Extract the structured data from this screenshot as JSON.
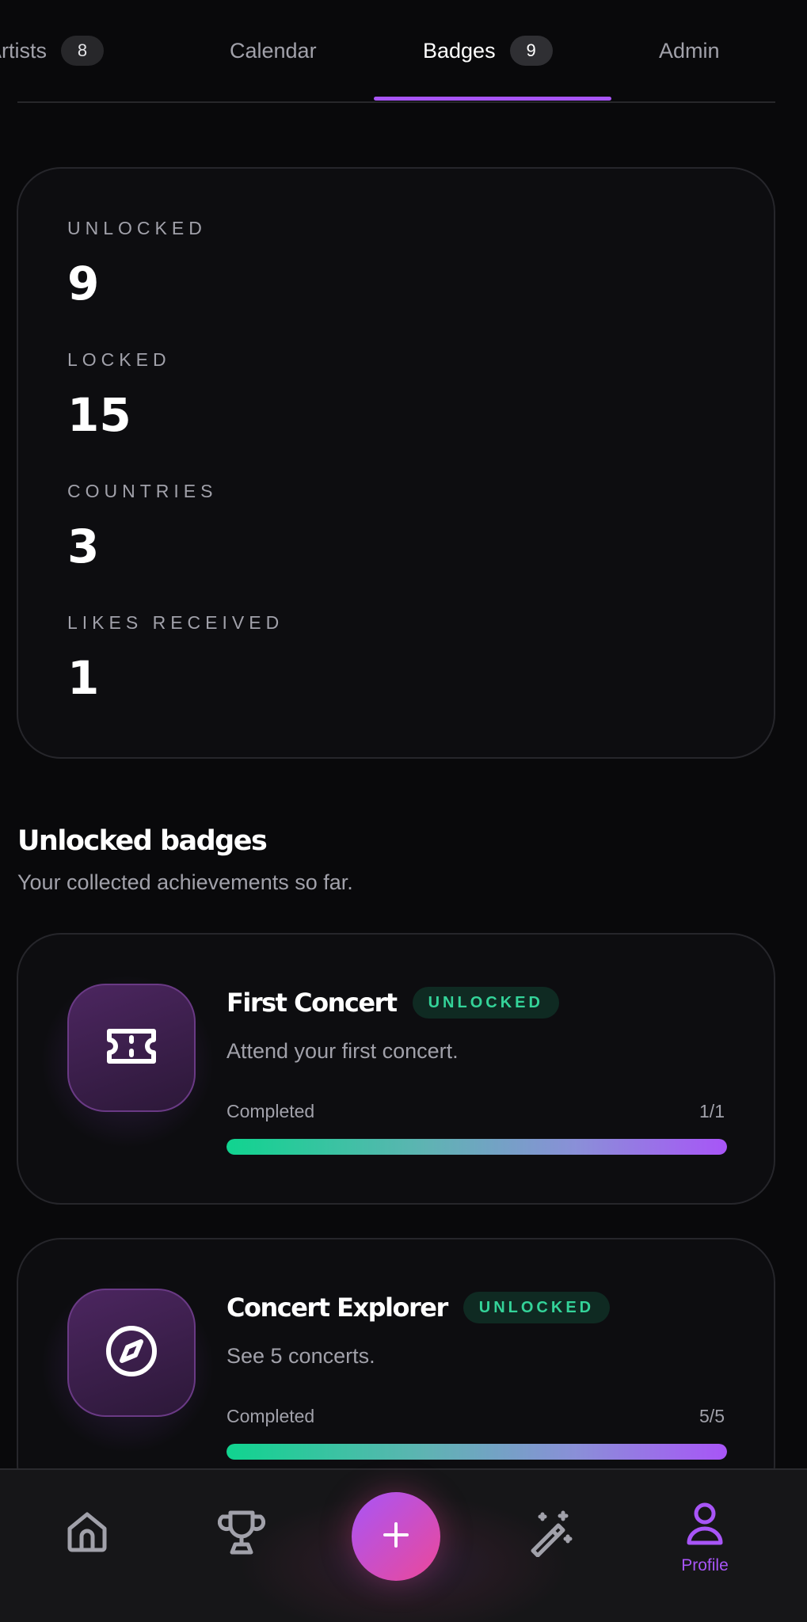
{
  "tabs": [
    {
      "label": "Artists",
      "count": "8",
      "active": false
    },
    {
      "label": "Calendar",
      "count": null,
      "active": false
    },
    {
      "label": "Badges",
      "count": "9",
      "active": true
    },
    {
      "label": "Admin",
      "count": null,
      "active": false
    }
  ],
  "stats": [
    {
      "label": "UNLOCKED",
      "value": "9"
    },
    {
      "label": "LOCKED",
      "value": "15"
    },
    {
      "label": "COUNTRIES",
      "value": "3"
    },
    {
      "label": "LIKES RECEIVED",
      "value": "1"
    }
  ],
  "section": {
    "title": "Unlocked badges",
    "subtitle": "Your collected achievements so far."
  },
  "badges": [
    {
      "title": "First Concert",
      "status": "UNLOCKED",
      "description": "Attend your first concert.",
      "progress_label": "Completed",
      "progress_count": "1/1",
      "progress_fraction": 1.0,
      "icon": "ticket-icon"
    },
    {
      "title": "Concert Explorer",
      "status": "UNLOCKED",
      "description": "See 5 concerts.",
      "progress_label": "Completed",
      "progress_count": "5/5",
      "progress_fraction": 1.0,
      "icon": "compass-icon"
    }
  ],
  "nav": {
    "items": [
      {
        "icon": "home-icon"
      },
      {
        "icon": "trophy-icon"
      },
      {
        "icon": "plus-icon"
      },
      {
        "icon": "magic-wand-icon"
      },
      {
        "icon": "user-icon",
        "label": "Profile",
        "active": true
      }
    ]
  },
  "colors": {
    "accent": "#a855f7",
    "success": "#34d399",
    "background": "#09090b"
  }
}
